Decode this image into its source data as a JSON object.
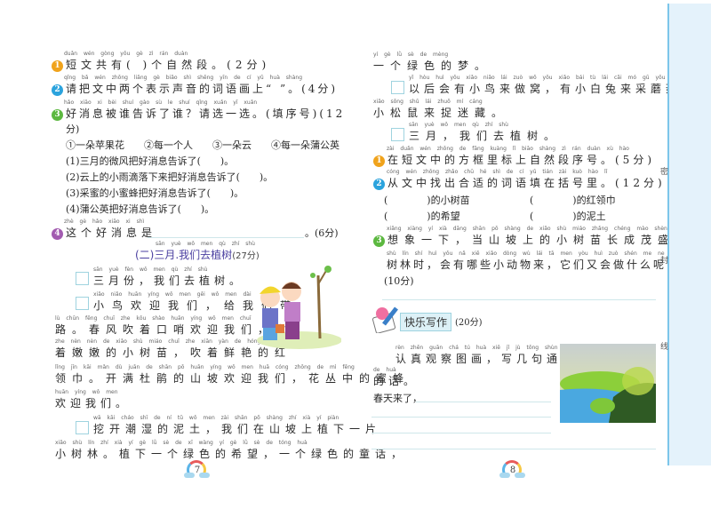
{
  "left": {
    "q1": {
      "py": "duǎn wén gòng yǒu         gè zì rán duàn",
      "text": "短文共有(    )个自然段。(2分)",
      "num": "1"
    },
    "q2": {
      "py": "qǐng bǎ wén zhōng liǎng gè biǎo shì shēng yīn de cí yǔ huà shàng",
      "text": "请把文中两个表示声音的词语画上“     ”。(4分)",
      "num": "2"
    },
    "q3": {
      "py": "hǎo xiāo xi bèi shuí gào sù le shuí    qǐng xuǎn yī xuǎn",
      "text": "好消息被谁告诉了谁？请选一选。(填序号)(12",
      "cont": "分)",
      "num": "3"
    },
    "options": "①一朵苹果花　　②每一个人　　③一朵云　　④每一朵蒲公英",
    "subs": [
      "(1)三月的微风把好消息告诉了(　　)。",
      "(2)云上的小雨滴落下来把好消息告诉了(　　)。",
      "(3)采蜜的小蜜蜂把好消息告诉了(　　)。",
      "(4)蒲公英把好消息告诉了(　　)。"
    ],
    "q4": {
      "py": "zhè gè hǎo xiāo xi shì",
      "text": "这个好消息是",
      "score": "。(6分)",
      "num": "4"
    },
    "section": {
      "py": "sān yuè   wǒ men qù zhí shù",
      "title": "(二)三月.我们去植树",
      "score": "(27分)"
    },
    "lines": [
      {
        "py": "sān yuè fèn   wǒ men qù zhí shù",
        "text": "三月份，我们去植树。"
      },
      {
        "py": "xiǎo niǎo huān yíng wǒ men  gěi wǒ men dài",
        "text": "小鸟欢迎我们，给我们带"
      },
      {
        "py": "lù   chūn fēng chuī zhe kǒu shào huān yíng wǒ men  chuī",
        "text": "路。春风吹着口哨欢迎我们，吹"
      },
      {
        "py": "zhe nèn nèn de xiǎo shù miáo  chuī zhe xiān yàn de hóng",
        "text": "着嫩嫩的小树苗，吹着鲜艳的红"
      },
      {
        "py": "lǐng jīn   kāi mǎn dù juān de shān pō huān yíng wǒ men  huā cóng zhōng de mì fēng",
        "text": "领巾。开满杜鹃的山坡欢迎我们，花丛中的蜜蜂"
      },
      {
        "py": "huān yíng wǒ men",
        "text": "欢迎我们。"
      },
      {
        "py": "wā kāi cháo shī de ní tǔ   wǒ men zài shān pō shàng zhí xià yí piàn",
        "text": "挖开潮湿的泥土，我们在山坡上植下一片"
      },
      {
        "py": "xiǎo shù lín   zhí xià yí gè lǜ sè de xī wàng   yí gè lǜ sè de tóng huà",
        "text": "小树林。植下一个绿色的希望，一个绿色的童话，"
      }
    ],
    "page": "7"
  },
  "right": {
    "lines": [
      {
        "py": "yí gè lǜ sè de mèng",
        "text": "一个绿色的梦。"
      },
      {
        "py": "yǐ hòu huì yǒu xiǎo niǎo lái zuò wō   yǒu xiǎo bái tù lái cǎi mó gū   yǒu",
        "text": "以后会有小鸟来做窝，有小白兔来采蘑菇，有"
      },
      {
        "py": "xiǎo sōng shǔ lái zhuō mí cáng",
        "text": "小松鼠来捉迷藏。"
      },
      {
        "py": "sān yuè   wǒ men qù zhí shù",
        "text": "三月，我们去植树。"
      }
    ],
    "q1": {
      "py": "zài duǎn wén zhōng de fāng kuàng lǐ biāo shàng zì rán duàn xù hào",
      "text": "在短文中的方框里标上自然段序号。(5分)",
      "num": "1"
    },
    "q2": {
      "py": "cóng wén zhōng zhǎo chū hé shì de cí yǔ tián zài kuò hào lǐ",
      "text": "从文中找出合适的词语填在括号里。(12分)",
      "num": "2"
    },
    "fills": [
      "(　　　　)的小树苗",
      "(　　　　)的红领巾",
      "(　　　　)的希望",
      "(　　　　)的泥土"
    ],
    "q3": {
      "py": "xiǎng xiàng yí xià   dāng shān pō shàng de xiǎo shù miáo zhǎng chéng mào shèng de",
      "text": "想象一下，当山坡上的小树苗长成茂盛的",
      "py2": "shù lín shí   huì yǒu nǎ xiē xiǎo dòng wù lái   tā men yòu huì zuò shén me ne",
      "text2": "树林时，会有哪些小动物来，它们又会做什么呢？",
      "score": "(10分)",
      "num": "3"
    },
    "writing": {
      "banner": "快乐写作",
      "score": "(20分)",
      "py": "rèn zhēn guān chá tú huà   xiě jǐ jù tōng shùn",
      "text": "认真观察图画，写几句通顺",
      "py2": "de huà",
      "text2": "的话。",
      "start": "春天来了，"
    },
    "page": "8"
  },
  "seal": [
    "密",
    "封",
    "线"
  ]
}
